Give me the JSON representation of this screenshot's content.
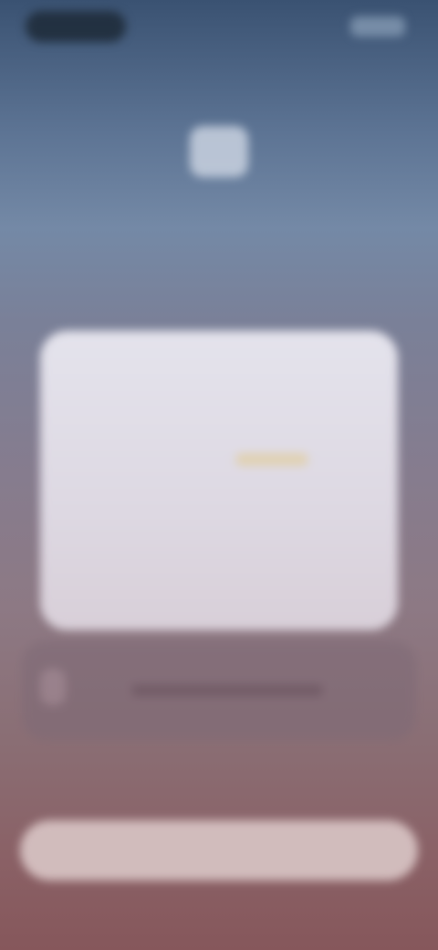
{
  "status_bar": {},
  "header": {
    "caption": "",
    "title": "",
    "subtitle": ""
  },
  "card": {
    "title": "",
    "description": "",
    "rows": [
      "",
      "",
      ""
    ],
    "link_label": ""
  },
  "secondary": {
    "line1": "",
    "line2": ""
  },
  "primary_button": {
    "label": ""
  },
  "colors": {
    "background_top": "#3a5272",
    "background_bottom": "#86575b",
    "card": "#e4e3ec",
    "button": "#d8c4c4"
  },
  "icons": {
    "header_icon": "app-icon",
    "secondary_icon": "info-icon"
  }
}
